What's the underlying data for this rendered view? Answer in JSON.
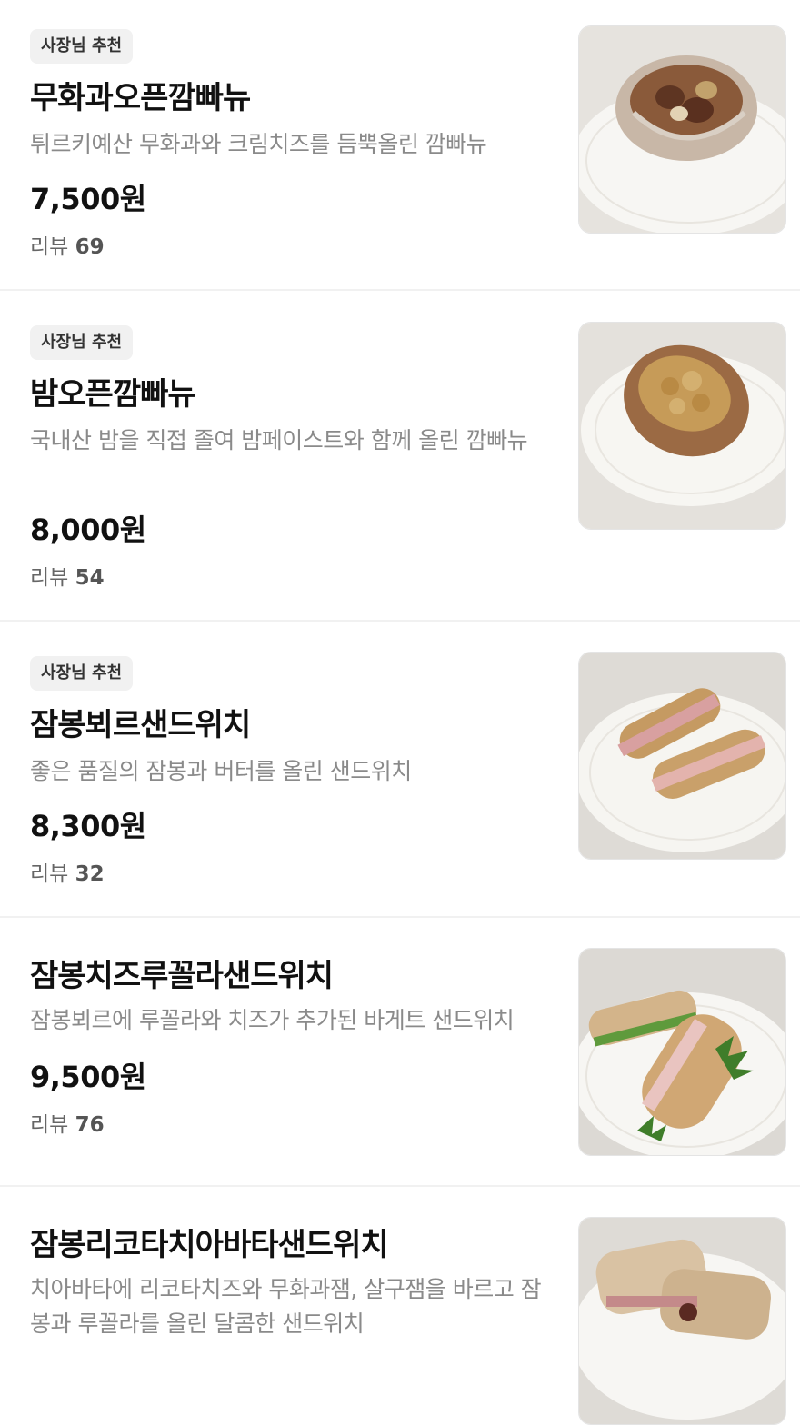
{
  "menu_items": [
    {
      "badge": "사장님 추천",
      "name": "무화과오픈깜빠뉴",
      "description": "튀르키예산 무화과와 크림치즈를 듬뿍올린 깜빠뉴",
      "price": "7,500원",
      "review_label": "리뷰",
      "review_count": "69",
      "image": "fig-open-campagne-photo"
    },
    {
      "badge": "사장님 추천",
      "name": "밤오픈깜빠뉴",
      "description": "국내산 밤을 직접 졸여 밤페이스트와 함께 올린 깜빠뉴",
      "price": "8,000원",
      "review_label": "리뷰",
      "review_count": "54",
      "image": "chestnut-open-campagne-photo"
    },
    {
      "badge": "사장님 추천",
      "name": "잠봉뵈르샌드위치",
      "description": "좋은 품질의 잠봉과 버터를 올린 샌드위치",
      "price": "8,300원",
      "review_label": "리뷰",
      "review_count": "32",
      "image": "jambon-beurre-sandwich-photo"
    },
    {
      "name": "잠봉치즈루꼴라샌드위치",
      "description": "잠봉뵈르에 루꼴라와 치즈가 추가된 바게트 샌드위치",
      "price": "9,500원",
      "review_label": "리뷰",
      "review_count": "76",
      "image": "jambon-cheese-arugula-sandwich-photo"
    },
    {
      "name": "잠봉리코타치아바타샌드위치",
      "description": "치아바타에 리코타치즈와 무화과잼, 살구잼을 바르고 잠봉과 루꼴라를 올린 달콤한 샌드위치",
      "image": "jambon-ricotta-ciabatta-sandwich-photo"
    }
  ]
}
